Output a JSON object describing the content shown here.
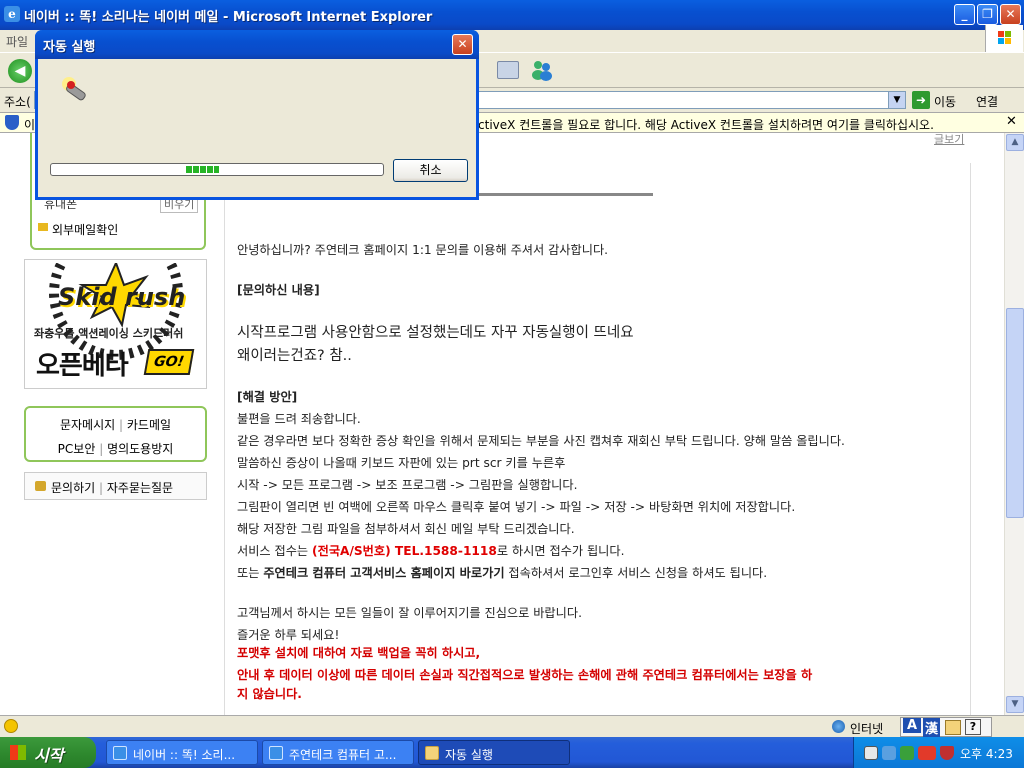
{
  "browser": {
    "title": "네이버 :: 똑! 소리나는 네이버 메일 - Microsoft Internet Explorer",
    "menu_visible": "파일",
    "address_label": "주소(",
    "go_label": "이동",
    "links_label": "연결",
    "infobar_text": "이 사이트는 ActiveX 컨트롤을 필요로 합니다. 해당 ActiveX 컨트롤을 설치하려면 여기를 클릭하십시오.",
    "infobar_visible_prefix": "이",
    "infobar_visible_text": "ctiveX 컨트롤을 필요로 합니다. 해당 ActiveX 컨트롤을 설치하려면 여기를 클릭하십시오.",
    "back_icon": "back-arrow-icon",
    "window_buttons": [
      "_",
      "❐",
      "✕"
    ]
  },
  "sidebar": {
    "mobile_item": "휴대폰",
    "mobile_clear": "비우기",
    "external_mail": "외부메일확인",
    "banner": {
      "logo": "Skid rush",
      "tagline": "좌충우돌 액션레이싱 스키드러쉬",
      "headline": "오픈베타",
      "go": "GO!"
    },
    "promo_links": [
      "문자메시지",
      "카드메일",
      "PC보안",
      "명의도용방지"
    ],
    "help_links": [
      "문의하기",
      "자주묻는질문"
    ]
  },
  "main": {
    "more_link": "글보기",
    "greeting": "안녕하십니까? 주연테크 홈페이지 1:1 문의를 이용해 주셔서 감사합니다.",
    "inquiry_heading": "[문의하신 내용]",
    "inquiry_line1": "시작프로그램 사용안함으로 설정했는데도 자꾸 자동실행이 뜨네요",
    "inquiry_line2": "왜이러는건죠? 참..",
    "solution_heading": "[해결 방안]",
    "solution_lines": [
      "불편을 드려 죄송합니다.",
      "같은 경우라면 보다 정확한 증상 확인을 위해서 문제되는 부분을 사진 캡쳐후 재회신 부탁 드립니다. 양해 말씀 올립니다.",
      "말씀하신 증상이 나올때 키보드 자판에 있는 prt scr 키를 누른후",
      "시작 -> 모든 프로그램 -> 보조 프로그램 -> 그림판을 실행합니다.",
      "그림판이 열리면 빈 여백에 오른쪽 마우스 클릭후 붙여 넣기 -> 파일 -> 저장 -> 바탕화면 위치에 저장합니다.",
      "해당 저장한 그림 파일을 첨부하셔서 회신 메일 부탁 드리겠습니다."
    ],
    "service_prefix": "서비스 접수는 ",
    "service_highlight": "(전국A/S번호) TEL.1588-1118",
    "service_suffix": "로 하시면 접수가 됩니다.",
    "or_prefix": "또는 ",
    "or_bold": "주연테크 컴퓨터 고객서비스 홈페이지 바로가기",
    "or_suffix": " 접속하셔서 로그인후 서비스 신청을 하셔도 됩니다.",
    "closing1": "고객님께서 하시는 모든 일들이 잘 이루어지기를 진심으로 바랍니다.",
    "closing2": "즐거운 하루 되세요!",
    "warning1": "포맷후 설치에 대하여 자료 백업을 꼭히 하시고,",
    "warning2": "안내 후 데이터 이상에 따른 데이터 손실과 직간접적으로 발생하는 손해에 관해 주연테크 컴퓨터에서는 보장을 하",
    "warning3": "지 않습니다."
  },
  "statusbar": {
    "zone": "인터넷",
    "ime_a": "A",
    "ime_han": "漢",
    "ime_help": "?"
  },
  "dialog": {
    "title": "자동 실행",
    "close": "✕",
    "cancel_label": "취소",
    "progress": 0.1
  },
  "taskbar": {
    "start_label": "시작",
    "tasks": [
      {
        "label": "네이버 :: 똑! 소리...",
        "icon": "ie-icon"
      },
      {
        "label": "주연테크 컴퓨터 고...",
        "icon": "ie-icon"
      },
      {
        "label": "자동 실행",
        "icon": "folder-icon"
      }
    ],
    "clock": "오후 4:23"
  },
  "colors": {
    "xp_blue": "#0a5fe0",
    "start_green": "#2f8a2f",
    "highlight_red": "#e00000",
    "sidebar_green": "#8fc65a"
  }
}
